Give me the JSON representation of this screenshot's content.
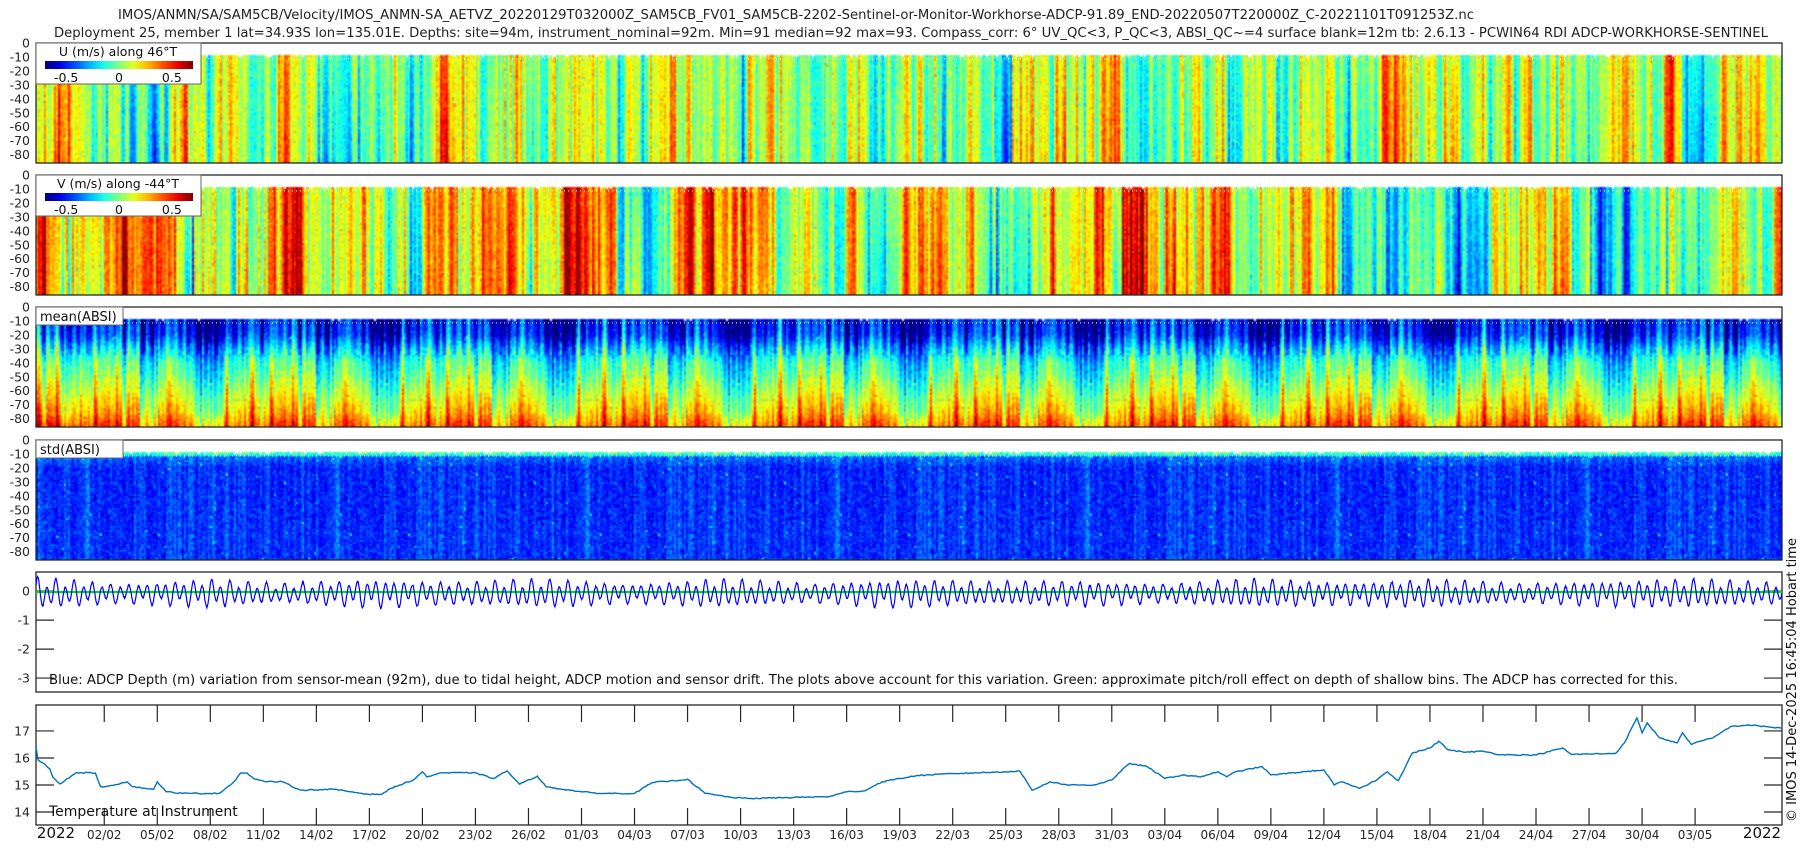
{
  "title": {
    "line1": "IMOS/ANMN/SA/SAM5CB/Velocity/IMOS_ANMN-SA_AETVZ_20220129T032000Z_SAM5CB_FV01_SAM5CB-2202-Sentinel-or-Monitor-Workhorse-ADCP-91.89_END-20220507T220000Z_C-20221101T091253Z.nc",
    "line2": "Deployment 25, member 1 lat=34.93S lon=135.01E. Depths: site=94m, instrument_nominal=92m. Min=91 median=92 max=93. Compass_corr: 6° UV_QC<3, P_QC<3, ABSI_QC~=4 surface blank=12m tb: 2.6.13 - PCWIN64 RDI ADCP-WORKHORSE-SENTINEL"
  },
  "side_note": "© IMOS 14-Dec-2025 16:45:04 Hobart time",
  "colors": {
    "axis": "#262626",
    "depth_line": "#0000ff",
    "pitch_roll_line": "#00dd00",
    "temperature_line": "#0072bd",
    "colormap": "jet"
  },
  "x_axis": {
    "start": "2022-01-29T03:20",
    "end": "2022-05-07T22:00",
    "year_label_left": "2022",
    "year_label_right": "2022",
    "tick_labels": [
      "02/02",
      "05/02",
      "08/02",
      "11/02",
      "14/02",
      "17/02",
      "20/02",
      "23/02",
      "26/02",
      "01/03",
      "04/03",
      "07/03",
      "10/03",
      "13/03",
      "16/03",
      "19/03",
      "22/03",
      "25/03",
      "28/03",
      "31/03",
      "03/04",
      "06/04",
      "09/04",
      "12/04",
      "15/04",
      "18/04",
      "21/04",
      "24/04",
      "27/04",
      "30/04",
      "03/05"
    ]
  },
  "chart_data": [
    {
      "type": "heatmap",
      "label": "U (m/s) along 46°T",
      "ylim": [
        -86,
        0
      ],
      "yticks": [
        "0",
        "-10",
        "-20",
        "-30",
        "-40",
        "-50",
        "-60",
        "-70",
        "-80"
      ],
      "data_top_depth": -8,
      "colorbar": {
        "clim": [
          -0.7,
          0.7
        ],
        "tick_labels": [
          "-0.5",
          "0",
          "0.5"
        ],
        "ticks": [
          -0.5,
          0,
          0.5
        ]
      },
      "approx_segment_means": [
        {
          "from": "2022-01-29",
          "to": "2022-02-20",
          "mean": 0.05
        },
        {
          "from": "2022-02-20",
          "to": "2022-03-08",
          "mean": 0.08
        },
        {
          "from": "2022-03-08",
          "to": "2022-04-13",
          "mean": 0.04
        },
        {
          "from": "2022-04-13",
          "to": "2022-04-17",
          "mean": 0.12
        },
        {
          "from": "2022-04-17",
          "to": "2022-05-08",
          "mean": 0.05
        }
      ]
    },
    {
      "type": "heatmap",
      "label": "V (m/s) along -44°T",
      "ylim": [
        -86,
        0
      ],
      "yticks": [
        "0",
        "-10",
        "-20",
        "-30",
        "-40",
        "-50",
        "-60",
        "-70",
        "-80"
      ],
      "data_top_depth": -8,
      "colorbar": {
        "clim": [
          -0.7,
          0.7
        ],
        "tick_labels": [
          "-0.5",
          "0",
          "0.5"
        ],
        "ticks": [
          -0.5,
          0,
          0.5
        ]
      },
      "approx_segment_means": [
        {
          "from": "2022-01-29",
          "to": "2022-02-07",
          "mean": 0.3
        },
        {
          "from": "2022-02-07",
          "to": "2022-02-11",
          "mean": -0.05
        },
        {
          "from": "2022-02-11",
          "to": "2022-02-17",
          "mean": 0.25
        },
        {
          "from": "2022-02-17",
          "to": "2022-02-20",
          "mean": 0.0
        },
        {
          "from": "2022-02-20",
          "to": "2022-03-03",
          "mean": 0.3
        },
        {
          "from": "2022-03-03",
          "to": "2022-03-06",
          "mean": -0.15
        },
        {
          "from": "2022-03-06",
          "to": "2022-03-12",
          "mean": 0.35
        },
        {
          "from": "2022-03-12",
          "to": "2022-03-17",
          "mean": -0.05
        },
        {
          "from": "2022-03-17",
          "to": "2022-03-22",
          "mean": 0.15
        },
        {
          "from": "2022-03-22",
          "to": "2022-03-30",
          "mean": 0.05
        },
        {
          "from": "2022-03-30",
          "to": "2022-04-02",
          "mean": 0.4
        },
        {
          "from": "2022-04-02",
          "to": "2022-04-08",
          "mean": 0.15
        },
        {
          "from": "2022-04-08",
          "to": "2022-04-13",
          "mean": 0.2
        },
        {
          "from": "2022-04-13",
          "to": "2022-04-23",
          "mean": -0.1
        },
        {
          "from": "2022-04-23",
          "to": "2022-04-26",
          "mean": 0.15
        },
        {
          "from": "2022-04-26",
          "to": "2022-04-27",
          "mean": 0.0
        },
        {
          "from": "2022-04-27",
          "to": "2022-04-30",
          "mean": -0.3
        },
        {
          "from": "2022-04-30",
          "to": "2022-05-08",
          "mean": 0.0
        }
      ]
    },
    {
      "type": "heatmap",
      "label": "mean(ABSI)",
      "ylim": [
        -86,
        0
      ],
      "yticks": [
        "0",
        "-10",
        "-20",
        "-30",
        "-40",
        "-50",
        "-60",
        "-70",
        "-80"
      ],
      "data_top_depth": -8,
      "approx_profile_normalized": {
        "depth": [
          -10,
          -20,
          -30,
          -40,
          -50,
          -60,
          -70,
          -80,
          -86
        ],
        "value": [
          0.12,
          0.15,
          0.3,
          0.42,
          0.48,
          0.55,
          0.62,
          0.68,
          0.75
        ]
      }
    },
    {
      "type": "heatmap",
      "label": "std(ABSI)",
      "ylim": [
        -86,
        0
      ],
      "yticks": [
        "0",
        "-10",
        "-20",
        "-30",
        "-40",
        "-50",
        "-60",
        "-70",
        "-80"
      ],
      "data_top_depth": -8,
      "approx_profile_normalized": {
        "depth": [
          -10,
          -12,
          -20,
          -86
        ],
        "value": [
          0.45,
          0.2,
          0.13,
          0.14
        ]
      }
    },
    {
      "type": "line",
      "caption": "Blue: ADCP Depth (m) variation from sensor-mean (92m), due to tidal height, ADCP motion and sensor drift. The plots above account for this variation. Green: approximate pitch/roll effect on depth of shallow bins. The ADCP has corrected for this.",
      "ylim": [
        -3.48,
        0.66
      ],
      "yticks": [
        "0",
        "-1",
        "-2",
        "-3"
      ],
      "approx_tidal_amplitude_m": {
        "dates": [
          "2022-01-29",
          "2022-02-03",
          "2022-02-08",
          "2022-02-12",
          "2022-02-17",
          "2022-02-22",
          "2022-02-27",
          "2022-03-04",
          "2022-03-09",
          "2022-03-14",
          "2022-03-19",
          "2022-03-24",
          "2022-03-29",
          "2022-04-03",
          "2022-04-08",
          "2022-04-13",
          "2022-04-18",
          "2022-04-23",
          "2022-04-28",
          "2022-05-03",
          "2022-05-07"
        ],
        "amplitude": [
          0.5,
          0.3,
          0.45,
          0.3,
          0.45,
          0.35,
          0.45,
          0.3,
          0.45,
          0.3,
          0.45,
          0.35,
          0.4,
          0.3,
          0.45,
          0.35,
          0.45,
          0.3,
          0.4,
          0.45,
          0.35
        ]
      },
      "pitch_roll_level_m": -0.03
    },
    {
      "type": "line",
      "label": "Temperature at Instrument",
      "ylim": [
        13.52,
        17.96
      ],
      "yticks": [
        "14",
        "15",
        "16",
        "17"
      ],
      "series": [
        [
          "2022-01-29T03:20",
          16.4
        ],
        [
          "2022-01-29T06:00",
          15.93
        ],
        [
          "2022-01-29T12:00",
          15.83
        ],
        [
          "2022-01-29T22:00",
          15.6
        ],
        [
          "2022-01-30T02:00",
          15.3
        ],
        [
          "2022-01-30T12:00",
          15.04
        ],
        [
          "2022-01-31T10:00",
          15.46
        ],
        [
          "2022-02-01T12:00",
          15.44
        ],
        [
          "2022-02-01T19:00",
          14.94
        ],
        [
          "2022-02-02T02:00",
          14.94
        ],
        [
          "2022-02-03T07:00",
          15.12
        ],
        [
          "2022-02-03T14:00",
          14.94
        ],
        [
          "2022-02-04T19:00",
          14.84
        ],
        [
          "2022-02-05T00:00",
          15.12
        ],
        [
          "2022-02-05T12:00",
          14.75
        ],
        [
          "2022-02-06T10:00",
          14.69
        ],
        [
          "2022-02-08T12:00",
          14.69
        ],
        [
          "2022-02-09T07:00",
          15.09
        ],
        [
          "2022-02-09T17:00",
          15.44
        ],
        [
          "2022-02-10T02:00",
          15.44
        ],
        [
          "2022-02-10T12:00",
          15.22
        ],
        [
          "2022-02-11T05:00",
          15.12
        ],
        [
          "2022-02-12T02:00",
          15.12
        ],
        [
          "2022-02-13T02:00",
          14.81
        ],
        [
          "2022-02-15T00:00",
          14.84
        ],
        [
          "2022-02-16T22:00",
          14.66
        ],
        [
          "2022-02-17T17:00",
          14.66
        ],
        [
          "2022-02-18T05:00",
          14.87
        ],
        [
          "2022-02-18T17:00",
          15.0
        ],
        [
          "2022-02-19T12:00",
          15.19
        ],
        [
          "2022-02-20T00:00",
          15.49
        ],
        [
          "2022-02-20T06:00",
          15.3
        ],
        [
          "2022-02-21T00:00",
          15.45
        ],
        [
          "2022-02-23T00:00",
          15.45
        ],
        [
          "2022-02-24T00:00",
          15.24
        ],
        [
          "2022-02-24T19:00",
          15.52
        ],
        [
          "2022-02-25T12:00",
          15.03
        ],
        [
          "2022-02-26T12:00",
          15.33
        ],
        [
          "2022-02-27T00:00",
          14.93
        ],
        [
          "2022-03-01T00:00",
          14.75
        ],
        [
          "2022-03-02T00:00",
          14.69
        ],
        [
          "2022-03-04T00:00",
          14.69
        ],
        [
          "2022-03-05T00:00",
          15.09
        ],
        [
          "2022-03-07T00:00",
          15.21
        ],
        [
          "2022-03-08T00:00",
          14.69
        ],
        [
          "2022-03-09T12:00",
          14.54
        ],
        [
          "2022-03-10T12:00",
          14.5
        ],
        [
          "2022-03-13T00:00",
          14.54
        ],
        [
          "2022-03-15T00:00",
          14.57
        ],
        [
          "2022-03-16T00:00",
          14.75
        ],
        [
          "2022-03-17T00:00",
          14.78
        ],
        [
          "2022-03-18T00:00",
          15.12
        ],
        [
          "2022-03-19T00:00",
          15.24
        ],
        [
          "2022-03-20T00:00",
          15.35
        ],
        [
          "2022-03-22T00:00",
          15.42
        ],
        [
          "2022-03-25T00:00",
          15.49
        ],
        [
          "2022-03-25T19:00",
          15.52
        ],
        [
          "2022-03-26T12:00",
          14.8
        ],
        [
          "2022-03-27T12:00",
          15.12
        ],
        [
          "2022-03-28T12:00",
          15.0
        ],
        [
          "2022-03-30T00:00",
          15.0
        ],
        [
          "2022-03-31T00:00",
          15.19
        ],
        [
          "2022-04-01T00:00",
          15.8
        ],
        [
          "2022-04-02T00:00",
          15.68
        ],
        [
          "2022-04-03T00:00",
          15.24
        ],
        [
          "2022-04-04T00:00",
          15.37
        ],
        [
          "2022-04-05T00:00",
          15.3
        ],
        [
          "2022-04-06T00:00",
          15.49
        ],
        [
          "2022-04-06T12:00",
          15.3
        ],
        [
          "2022-04-07T00:00",
          15.49
        ],
        [
          "2022-04-08T12:00",
          15.68
        ],
        [
          "2022-04-09T00:00",
          15.37
        ],
        [
          "2022-04-12T00:00",
          15.56
        ],
        [
          "2022-04-12T14:00",
          15.0
        ],
        [
          "2022-04-13T00:00",
          15.12
        ],
        [
          "2022-04-14T00:00",
          14.87
        ],
        [
          "2022-04-15T00:00",
          15.19
        ],
        [
          "2022-04-15T14:00",
          15.49
        ],
        [
          "2022-04-16T05:00",
          15.16
        ],
        [
          "2022-04-17T00:00",
          16.18
        ],
        [
          "2022-04-18T00:00",
          16.37
        ],
        [
          "2022-04-18T12:00",
          16.62
        ],
        [
          "2022-04-19T00:00",
          16.31
        ],
        [
          "2022-04-20T00:00",
          16.21
        ],
        [
          "2022-04-21T00:00",
          16.25
        ],
        [
          "2022-04-22T00:00",
          16.12
        ],
        [
          "2022-04-24T00:00",
          16.11
        ],
        [
          "2022-04-25T12:00",
          16.37
        ],
        [
          "2022-04-26T00:00",
          16.13
        ],
        [
          "2022-04-28T12:00",
          16.17
        ],
        [
          "2022-04-29T00:00",
          16.56
        ],
        [
          "2022-04-29T17:00",
          17.48
        ],
        [
          "2022-04-30T00:00",
          16.93
        ],
        [
          "2022-04-30T07:00",
          17.3
        ],
        [
          "2022-05-01T00:00",
          16.74
        ],
        [
          "2022-05-02T00:00",
          16.56
        ],
        [
          "2022-05-02T07:00",
          16.93
        ],
        [
          "2022-05-02T19:00",
          16.5
        ],
        [
          "2022-05-03T00:00",
          16.56
        ],
        [
          "2022-05-04T00:00",
          16.74
        ],
        [
          "2022-05-05T00:00",
          17.16
        ],
        [
          "2022-05-06T00:00",
          17.22
        ],
        [
          "2022-05-07T00:00",
          17.16
        ],
        [
          "2022-05-07T22:00",
          17.1
        ]
      ]
    }
  ]
}
